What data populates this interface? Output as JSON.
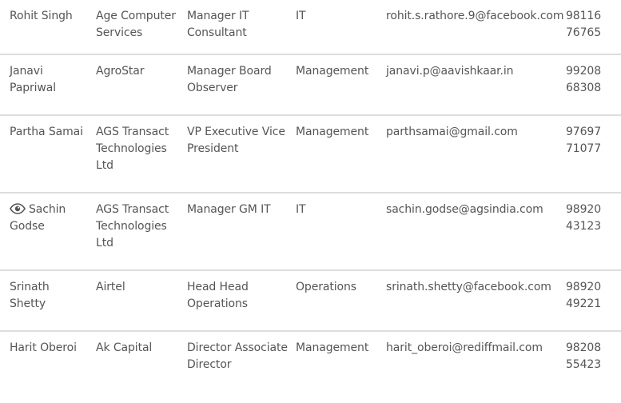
{
  "contacts": [
    {
      "name": "Rohit Singh",
      "company": "Age Computer Services",
      "designation": "Manager IT Consultant",
      "department": "IT",
      "email": "rohit.s.rathore.9@facebook.com",
      "phone": [
        "98116",
        "76765"
      ],
      "viewed": false
    },
    {
      "name": "Janavi Papriwal",
      "company": "AgroStar",
      "designation": "Manager Board Observer",
      "department": "Management",
      "email": "janavi.p@aavishkaar.in",
      "phone": [
        "99208",
        "68308"
      ],
      "viewed": false
    },
    {
      "name": "Partha Samai",
      "company": "AGS Transact Technologies Ltd",
      "designation": "VP Executive Vice President",
      "department": "Management",
      "email": "parthsamai@gmail.com",
      "phone": [
        "97697",
        "71077"
      ],
      "viewed": false
    },
    {
      "name": "Sachin Godse",
      "company": "AGS Transact Technologies Ltd",
      "designation": "Manager GM IT",
      "department": "IT",
      "email": "sachin.godse@agsindia.com",
      "phone": [
        "98920",
        "43123"
      ],
      "viewed": true,
      "viewed_icon": "eye-icon"
    },
    {
      "name": "Srinath Shetty",
      "company": "Airtel",
      "designation": "Head Head Operations",
      "department": "Operations",
      "email": "srinath.shetty@facebook.com",
      "phone": [
        "98920",
        "49221"
      ],
      "viewed": false
    },
    {
      "name": "Harit Oberoi",
      "company": "Ak Capital",
      "designation": "Director Associate Director",
      "department": "Management",
      "email": "harit_oberoi@rediffmail.com",
      "phone": [
        "98208",
        "55423"
      ],
      "viewed": false
    }
  ]
}
